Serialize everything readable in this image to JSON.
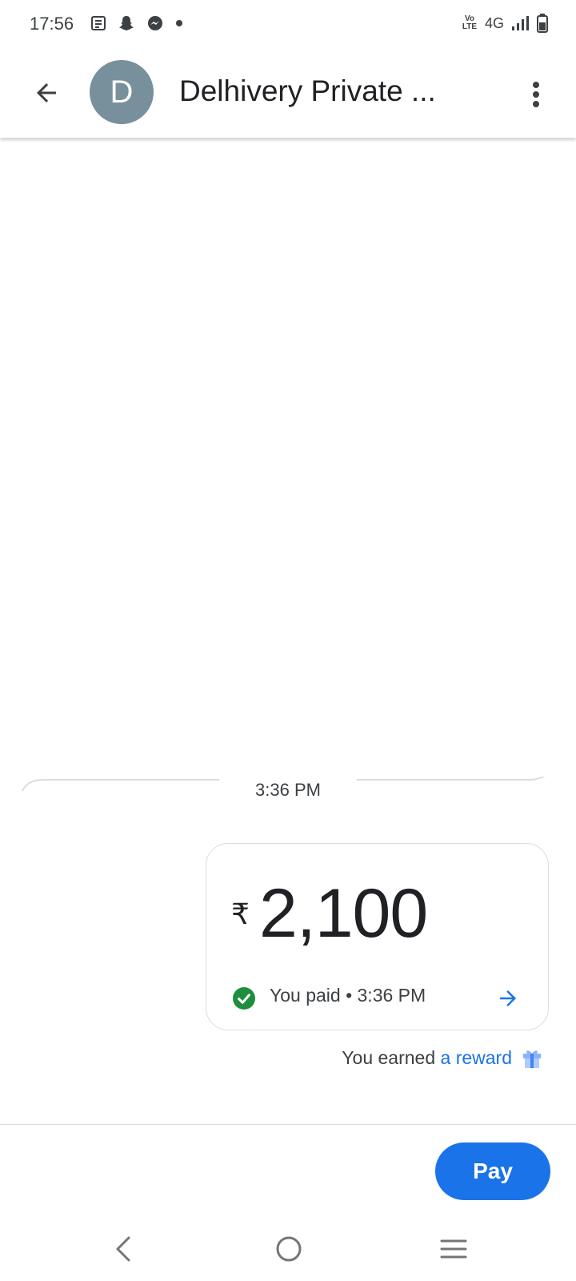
{
  "status_bar": {
    "time": "17:56",
    "network": "4G",
    "volte_top": "Vo",
    "volte_bottom": "LTE",
    "icons": [
      "news-icon",
      "snapchat-icon",
      "messenger-icon",
      "dot-icon",
      "signal-icon",
      "battery-icon"
    ]
  },
  "header": {
    "avatar_letter": "D",
    "contact_name": "Delhivery Private ...",
    "avatar_color": "#78909c"
  },
  "conversation": {
    "timestamp": "3:36 PM",
    "payment": {
      "currency_symbol": "₹",
      "amount": "2,100",
      "status": "You paid • 3:36 PM",
      "status_color": "#1e8e3e"
    },
    "reward": {
      "prefix": "You earned",
      "link": "a reward"
    }
  },
  "actions": {
    "pay_label": "Pay",
    "accent": "#1a73e8"
  },
  "navigation": {
    "icons": [
      "back-nav-icon",
      "home-nav-icon",
      "recents-nav-icon"
    ]
  }
}
